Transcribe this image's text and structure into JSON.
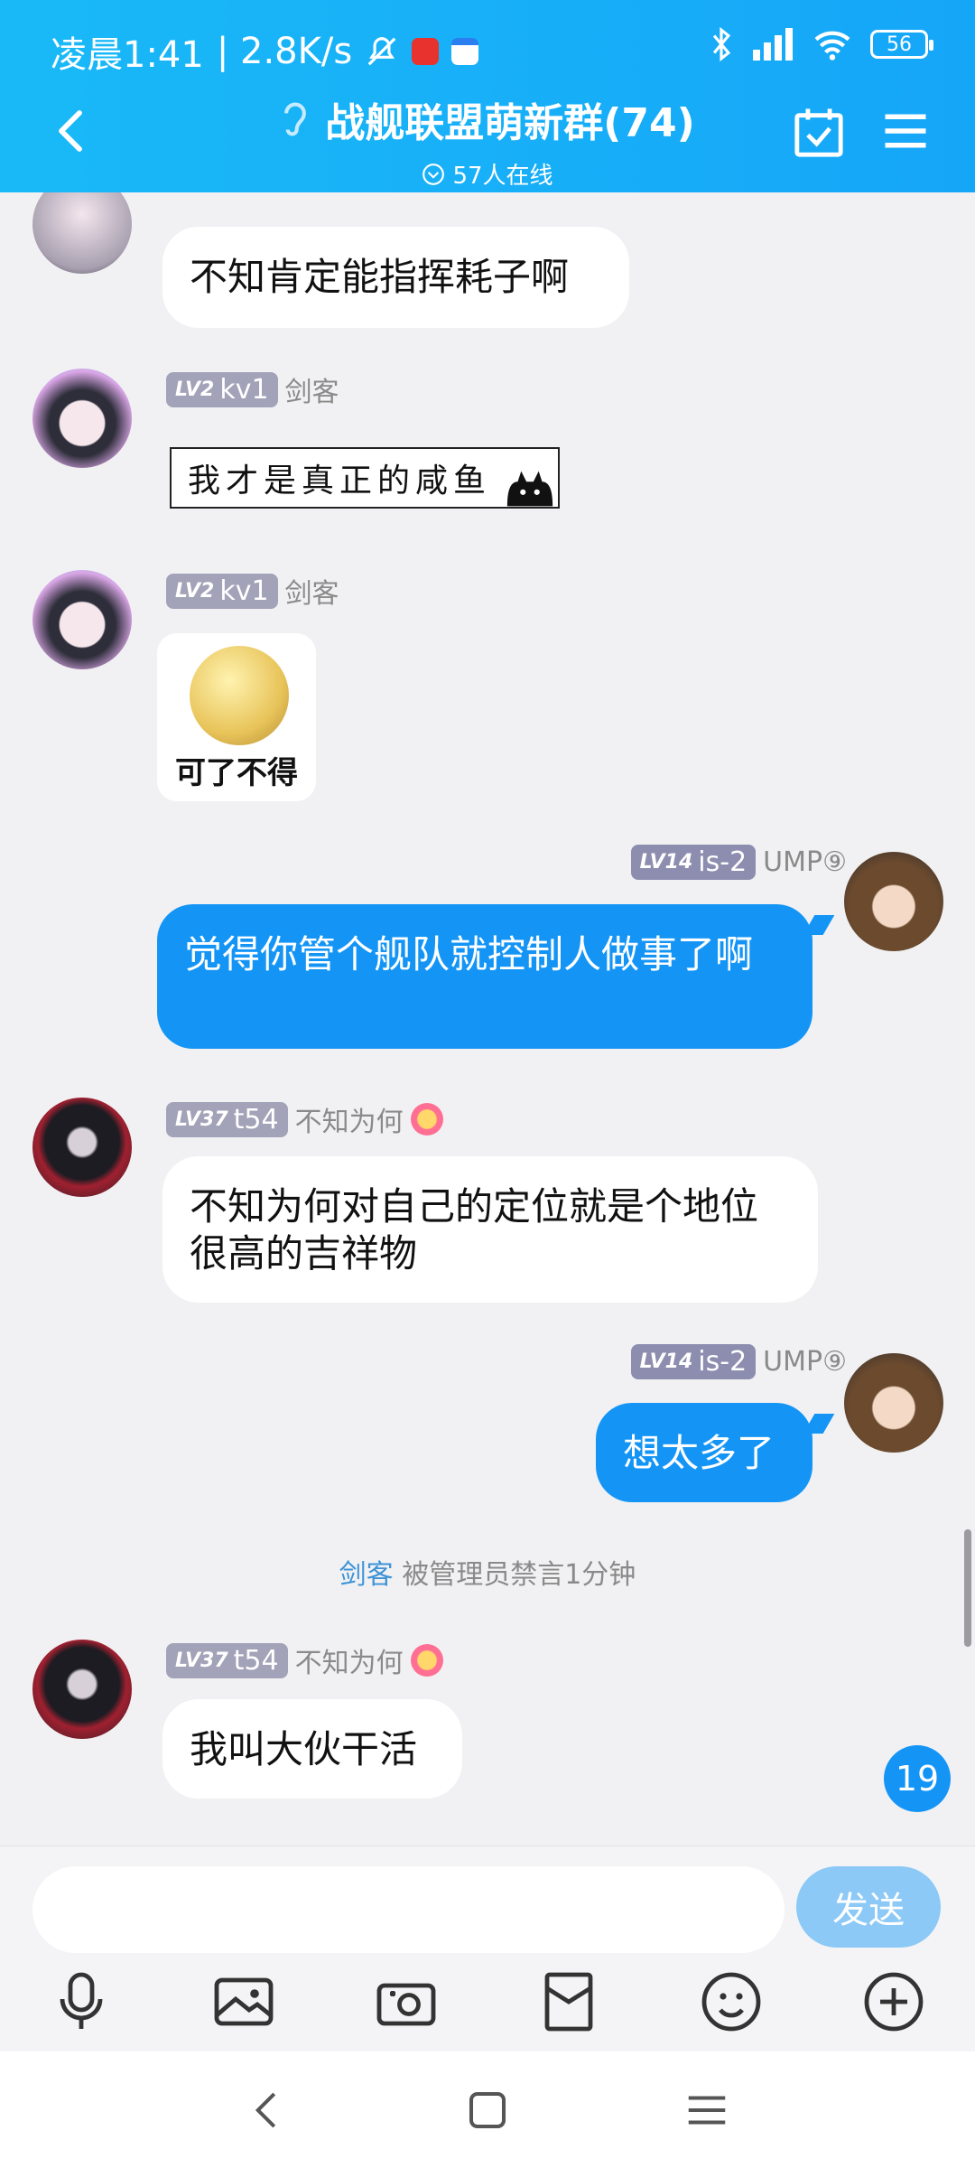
{
  "status": {
    "time": "凌晨1:41",
    "speed": "| 2.8K/s",
    "battery": "56"
  },
  "header": {
    "title": "战舰联盟萌新群(74)",
    "online": "57人在线"
  },
  "messages": [
    {
      "text": "不知肯定能指挥耗子啊"
    },
    {
      "lv": "LV2",
      "tag": "kv1",
      "name": "剑客",
      "sticker": "我才是真正的咸鱼"
    },
    {
      "lv": "LV2",
      "tag": "kv1",
      "name": "剑客",
      "sticker": "可了不得"
    },
    {
      "lv": "LV14",
      "tag": "is-2",
      "name": "UMP⑨",
      "text": "觉得你管个舰队就控制人做事了啊"
    },
    {
      "lv": "LV37",
      "tag": "t54",
      "name": "不知为何",
      "text": "不知为何对自己的定位就是个地位很高的吉祥物"
    },
    {
      "lv": "LV14",
      "tag": "is-2",
      "name": "UMP⑨",
      "text": "想太多了"
    },
    {
      "lv": "LV37",
      "tag": "t54",
      "name": "不知为何",
      "text": "我叫大伙干活"
    }
  ],
  "system": {
    "who": "剑客",
    "text": "被管理员禁言1分钟"
  },
  "unread_count": "19",
  "input": {
    "placeholder": "",
    "send_label": "发送"
  },
  "icons": [
    "microphone-icon",
    "image-icon",
    "camera-icon",
    "red-packet-icon",
    "emoji-icon",
    "plus-icon"
  ],
  "colors": {
    "header": "#17AEF8",
    "bubble_out": "#1495F6",
    "send": "#8CC9F7"
  }
}
